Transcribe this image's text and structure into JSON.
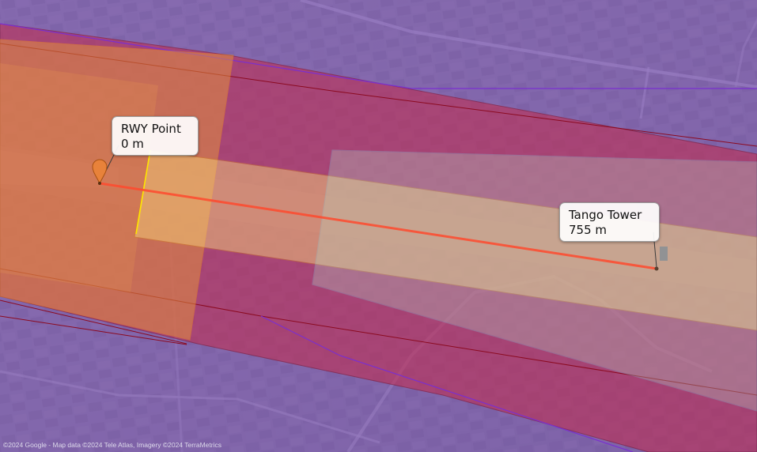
{
  "map": {
    "basemap": "satellite",
    "attribution": "©2024 Google - Map data ©2024 Tele Atlas, Imagery ©2024 TerraMetrics"
  },
  "markers": [
    {
      "name": "RWY Point",
      "distance_label": "0 m",
      "icon": "map-pin-icon",
      "color": "#e8823a"
    },
    {
      "name": "Tango Tower",
      "distance_label": "755 m",
      "icon": "point-icon",
      "color": "#5a4030"
    }
  ],
  "route": {
    "color": "#ff4a2e"
  },
  "zones": {
    "outer_color": "#8a5cd6",
    "middle_color": "#c02840",
    "inner_color": "#e8a030",
    "runway_corridor_color": "#ffe98a",
    "tango_zone_color": "#a0d0e0"
  }
}
